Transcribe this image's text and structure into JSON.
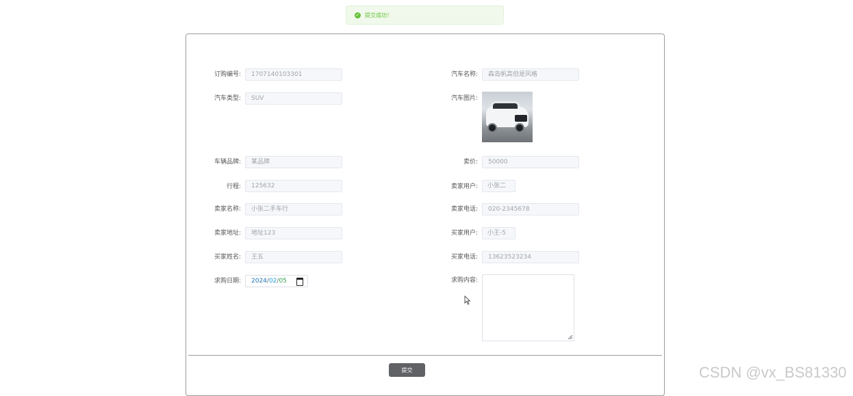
{
  "toast": {
    "message": "提交成功！"
  },
  "form": {
    "order_no": {
      "label": "订购编号:",
      "value": "1707140103301"
    },
    "car_name": {
      "label": "汽车名称:",
      "value": "森岛帆高但是风格"
    },
    "car_type": {
      "label": "汽车类型:",
      "value": "SUV"
    },
    "car_image": {
      "label": "汽车图片:"
    },
    "brand": {
      "label": "车辆品牌:",
      "value": "某品牌"
    },
    "price": {
      "label": "卖价:",
      "value": "50000"
    },
    "mileage": {
      "label": "行程:",
      "value": "125632"
    },
    "seller_user": {
      "label": "卖家用户:",
      "value": "小张二"
    },
    "seller_name": {
      "label": "卖家名称:",
      "value": "小张二手车行"
    },
    "seller_phone": {
      "label": "卖家电话:",
      "value": "020-2345678"
    },
    "seller_address": {
      "label": "卖家地址:",
      "value": "地址123"
    },
    "buyer_user": {
      "label": "买家用户:",
      "value": "小王-5"
    },
    "buyer_name": {
      "label": "买家姓名:",
      "value": "王五"
    },
    "buyer_phone": {
      "label": "买家电话:",
      "value": "13623523234"
    },
    "purchase_date": {
      "label": "求购日期:",
      "year": "2024",
      "month": "02",
      "day": "05"
    },
    "content": {
      "label": "求购内容:",
      "value": ""
    }
  },
  "submit_label": "提交",
  "watermark": "CSDN @vx_BS81330",
  "colors": {
    "success": "#67c23a",
    "button": "#606266"
  }
}
